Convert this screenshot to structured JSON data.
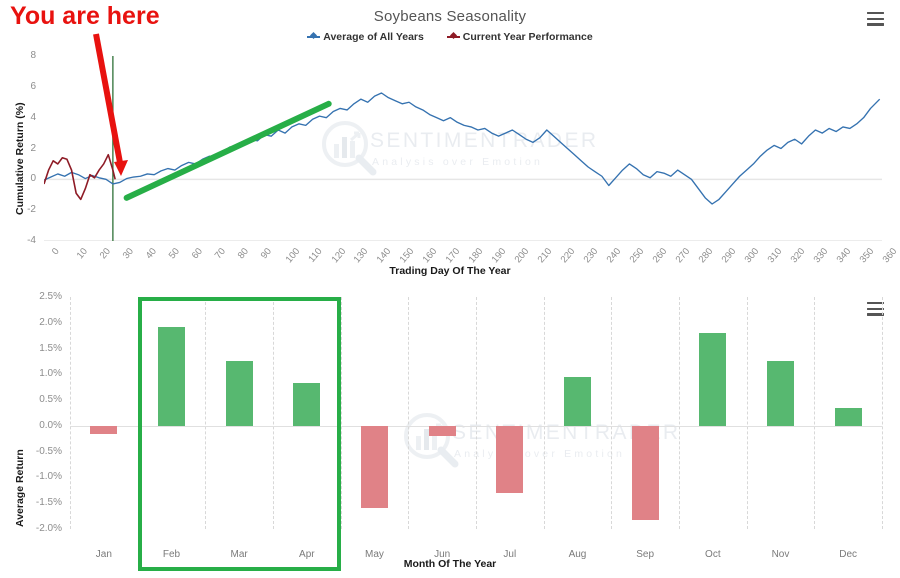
{
  "annotations": {
    "you_are_here": "You are here",
    "arrow_color": "#e8120f",
    "highlight_box_color": "#27ae47",
    "current_day_line_color": "#3d7b45",
    "trend_line_color": "#27ae47"
  },
  "watermark": {
    "line1": "SENTIMENTRADER",
    "line2": "Analysis over Emotion"
  },
  "top_chart": {
    "title": "Soybeans Seasonality",
    "menu_icon": "hamburger-menu-icon",
    "legend": [
      {
        "label": "Average of All Years",
        "color": "#3572b0"
      },
      {
        "label": "Current Year Performance",
        "color": "#8e1b26"
      }
    ]
  },
  "bottom_chart": {
    "menu_icon": "hamburger-menu-icon"
  },
  "chart_data": [
    {
      "type": "line",
      "title": "Soybeans Seasonality",
      "xlabel": "Trading Day Of The Year",
      "ylabel": "Cumulative Return (%)",
      "xlim": [
        0,
        365
      ],
      "ylim": [
        -4,
        8
      ],
      "yticks": [
        8,
        6,
        4,
        2,
        0,
        -2,
        -4
      ],
      "xticks": [
        0,
        10,
        20,
        30,
        40,
        50,
        60,
        70,
        80,
        90,
        100,
        110,
        120,
        130,
        140,
        150,
        160,
        170,
        180,
        190,
        200,
        210,
        220,
        230,
        240,
        250,
        260,
        270,
        280,
        290,
        300,
        310,
        320,
        330,
        340,
        350,
        360
      ],
      "grid": false,
      "legend_position": "top-center",
      "series": [
        {
          "name": "Average of All Years",
          "color": "#3572b0",
          "x": [
            0,
            3,
            6,
            9,
            12,
            15,
            18,
            21,
            24,
            27,
            30,
            33,
            36,
            39,
            42,
            45,
            48,
            51,
            54,
            57,
            60,
            63,
            66,
            69,
            72,
            75,
            78,
            81,
            84,
            87,
            90,
            93,
            96,
            99,
            102,
            105,
            108,
            111,
            114,
            117,
            120,
            123,
            126,
            129,
            132,
            135,
            138,
            141,
            144,
            147,
            150,
            153,
            156,
            159,
            162,
            165,
            168,
            171,
            174,
            177,
            180,
            183,
            186,
            189,
            192,
            195,
            198,
            201,
            204,
            207,
            210,
            213,
            216,
            219,
            222,
            225,
            228,
            231,
            234,
            237,
            240,
            243,
            246,
            249,
            252,
            255,
            258,
            261,
            264,
            267,
            270,
            273,
            276,
            279,
            282,
            285,
            288,
            291,
            294,
            297,
            300,
            303,
            306,
            309,
            312,
            315,
            318,
            321,
            324,
            327,
            330,
            333,
            336,
            339,
            342,
            345,
            348,
            351,
            354,
            357,
            360,
            364
          ],
          "y": [
            -0.05,
            0.15,
            0.35,
            0.2,
            0.45,
            0.3,
            0.05,
            0.25,
            0.1,
            0.0,
            -0.3,
            -0.2,
            0.05,
            0.15,
            0.2,
            0.35,
            0.3,
            0.55,
            0.7,
            0.6,
            0.9,
            1.1,
            1.0,
            1.3,
            1.5,
            1.4,
            1.8,
            2.1,
            2.0,
            2.4,
            2.6,
            2.5,
            2.9,
            2.8,
            3.2,
            3.0,
            3.4,
            3.6,
            3.5,
            3.9,
            4.1,
            4.0,
            4.4,
            4.6,
            4.5,
            4.9,
            5.2,
            5.0,
            5.4,
            5.6,
            5.3,
            5.1,
            4.9,
            5.0,
            4.7,
            4.5,
            4.2,
            4.0,
            3.8,
            4.0,
            3.7,
            3.5,
            3.4,
            3.2,
            3.3,
            3.0,
            2.8,
            3.0,
            3.2,
            2.9,
            2.6,
            2.4,
            2.7,
            3.2,
            2.8,
            2.4,
            2.0,
            1.6,
            1.2,
            0.8,
            0.5,
            0.2,
            -0.4,
            0.1,
            0.6,
            1.0,
            0.7,
            0.3,
            0.1,
            0.5,
            0.4,
            0.2,
            0.6,
            0.3,
            0.0,
            -0.6,
            -1.2,
            -1.6,
            -1.3,
            -0.8,
            -0.3,
            0.2,
            0.6,
            1.0,
            1.5,
            1.9,
            2.2,
            2.0,
            2.4,
            2.6,
            2.3,
            2.8,
            3.2,
            3.0,
            3.3,
            3.1,
            3.4,
            3.3,
            3.6,
            4.0,
            4.6,
            5.2,
            6.0,
            5.5
          ]
        },
        {
          "name": "Current Year Performance",
          "color": "#8e1b26",
          "x": [
            0,
            2,
            4,
            6,
            8,
            10,
            12,
            14,
            16,
            18,
            20,
            22,
            24,
            26,
            28,
            30,
            31
          ],
          "y": [
            -0.3,
            0.6,
            1.2,
            1.0,
            1.4,
            1.3,
            0.6,
            -0.9,
            -1.3,
            -0.6,
            0.3,
            0.1,
            0.6,
            1.0,
            1.6,
            0.6,
            0.0
          ]
        }
      ],
      "annotations": {
        "current_day_marker_x": 30,
        "you_are_here_label": "You are here",
        "trend_line": {
          "x1": 36,
          "y1": -1.2,
          "x2": 124,
          "y2": 4.9
        }
      }
    },
    {
      "type": "bar",
      "xlabel": "Month Of The Year",
      "ylabel": "Average Return",
      "categories": [
        "Jan",
        "Feb",
        "Mar",
        "Apr",
        "May",
        "Jun",
        "Jul",
        "Aug",
        "Sep",
        "Oct",
        "Nov",
        "Dec"
      ],
      "values": [
        -0.15,
        1.92,
        1.25,
        0.83,
        -1.6,
        -0.2,
        -1.3,
        0.95,
        -1.83,
        1.8,
        1.25,
        0.35
      ],
      "unit": "%",
      "ylim": [
        -2.0,
        2.5
      ],
      "yticks": [
        "2.5%",
        "2.0%",
        "1.5%",
        "1.0%",
        "0.5%",
        "0.0%",
        "-0.5%",
        "-1.0%",
        "-1.5%",
        "-2.0%"
      ],
      "ytick_values": [
        2.5,
        2.0,
        1.5,
        1.0,
        0.5,
        0.0,
        -0.5,
        -1.0,
        -1.5,
        -2.0
      ],
      "positive_color": "#57b870",
      "negative_color": "#e08287",
      "grid": true,
      "highlighted_categories": [
        "Feb",
        "Mar",
        "Apr"
      ]
    }
  ]
}
